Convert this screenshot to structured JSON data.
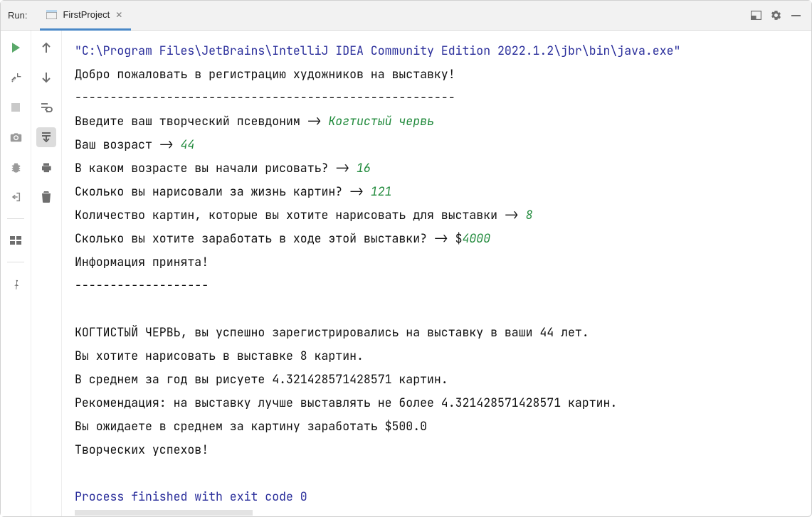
{
  "header": {
    "run_label": "Run:",
    "tab_title": "FirstProject"
  },
  "console": {
    "path": "\"C:\\Program Files\\JetBrains\\IntelliJ IDEA Community Edition 2022.1.2\\jbr\\bin\\java.exe\"",
    "line_welcome": "Добро пожаловать в регистрацию художников на выставку!",
    "dash_long": "------------------------------------------------------",
    "p_alias": "Введите ваш творческий псевдоним -> ",
    "v_alias": "Когтистый червь",
    "p_age": "Ваш возраст -> ",
    "v_age": "44",
    "p_start": "В каком возрасте вы начали рисовать? -> ",
    "v_start": "16",
    "p_count": "Сколько вы нарисовали за жизнь картин? -> ",
    "v_count": "121",
    "p_exh": "Количество картин, которые вы хотите нарисовать для выставки -> ",
    "v_exh": "8",
    "p_earn": "Сколько вы хотите заработать в ходе этой выставки? -> $",
    "v_earn": "4000",
    "accepted": "Информация принята!",
    "dash_short": "-------------------",
    "reg_ok": "КОГТИСТЫЙ ЧЕРВЬ, вы успешно зарегистрировались на выставку в ваши 44 лет.",
    "want_paint": "Вы хотите нарисовать в выставке 8 картин.",
    "avg_year": "В среднем за год вы рисуете 4.321428571428571 картин.",
    "recommend": "Рекомендация: на выставку лучше выставлять не более 4.321428571428571 картин.",
    "earn_avg": "Вы ожидаете в среднем за картину заработать $500.0",
    "creative": "Творческих успехов!",
    "exit": "Process finished with exit code 0"
  }
}
